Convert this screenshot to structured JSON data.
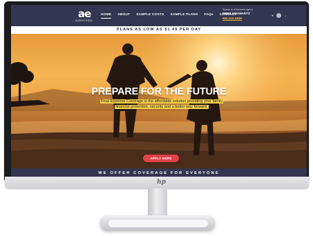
{
  "logo": {
    "mark": "ae",
    "subtitle": "AGENTREEL"
  },
  "nav": {
    "items": [
      {
        "label": "HOME",
        "active": true
      },
      {
        "label": "ABOUT"
      },
      {
        "label": "SAMPLE COSTS"
      },
      {
        "label": "SAMPLE PLANS"
      },
      {
        "label": "FAQs"
      },
      {
        "label": "CONTACT"
      }
    ]
  },
  "agent": {
    "line1": "Speak to a licensed agent",
    "name": "FRED SCHWARTZ",
    "phone": "866.815.6888"
  },
  "promo": {
    "text": "PLANS AS LOW AS $1.49 PER DAY"
  },
  "hero": {
    "title": "PREPARE FOR THE FUTURE",
    "subtitle_line1": "Final Expense Coverage is the affordable solution providing your family",
    "subtitle_line2": "financial protection, security and a better way forward.",
    "cta": "APPLY HERE"
  },
  "coverage": {
    "text": "WE OFFER COVERAGE FOR EVERYONE"
  },
  "monitor": {
    "brand": "hp"
  },
  "colors": {
    "nav_bg": "#343550",
    "cta": "#e14248",
    "highlight": "#f5d24b",
    "phone": "#e6b73a"
  }
}
